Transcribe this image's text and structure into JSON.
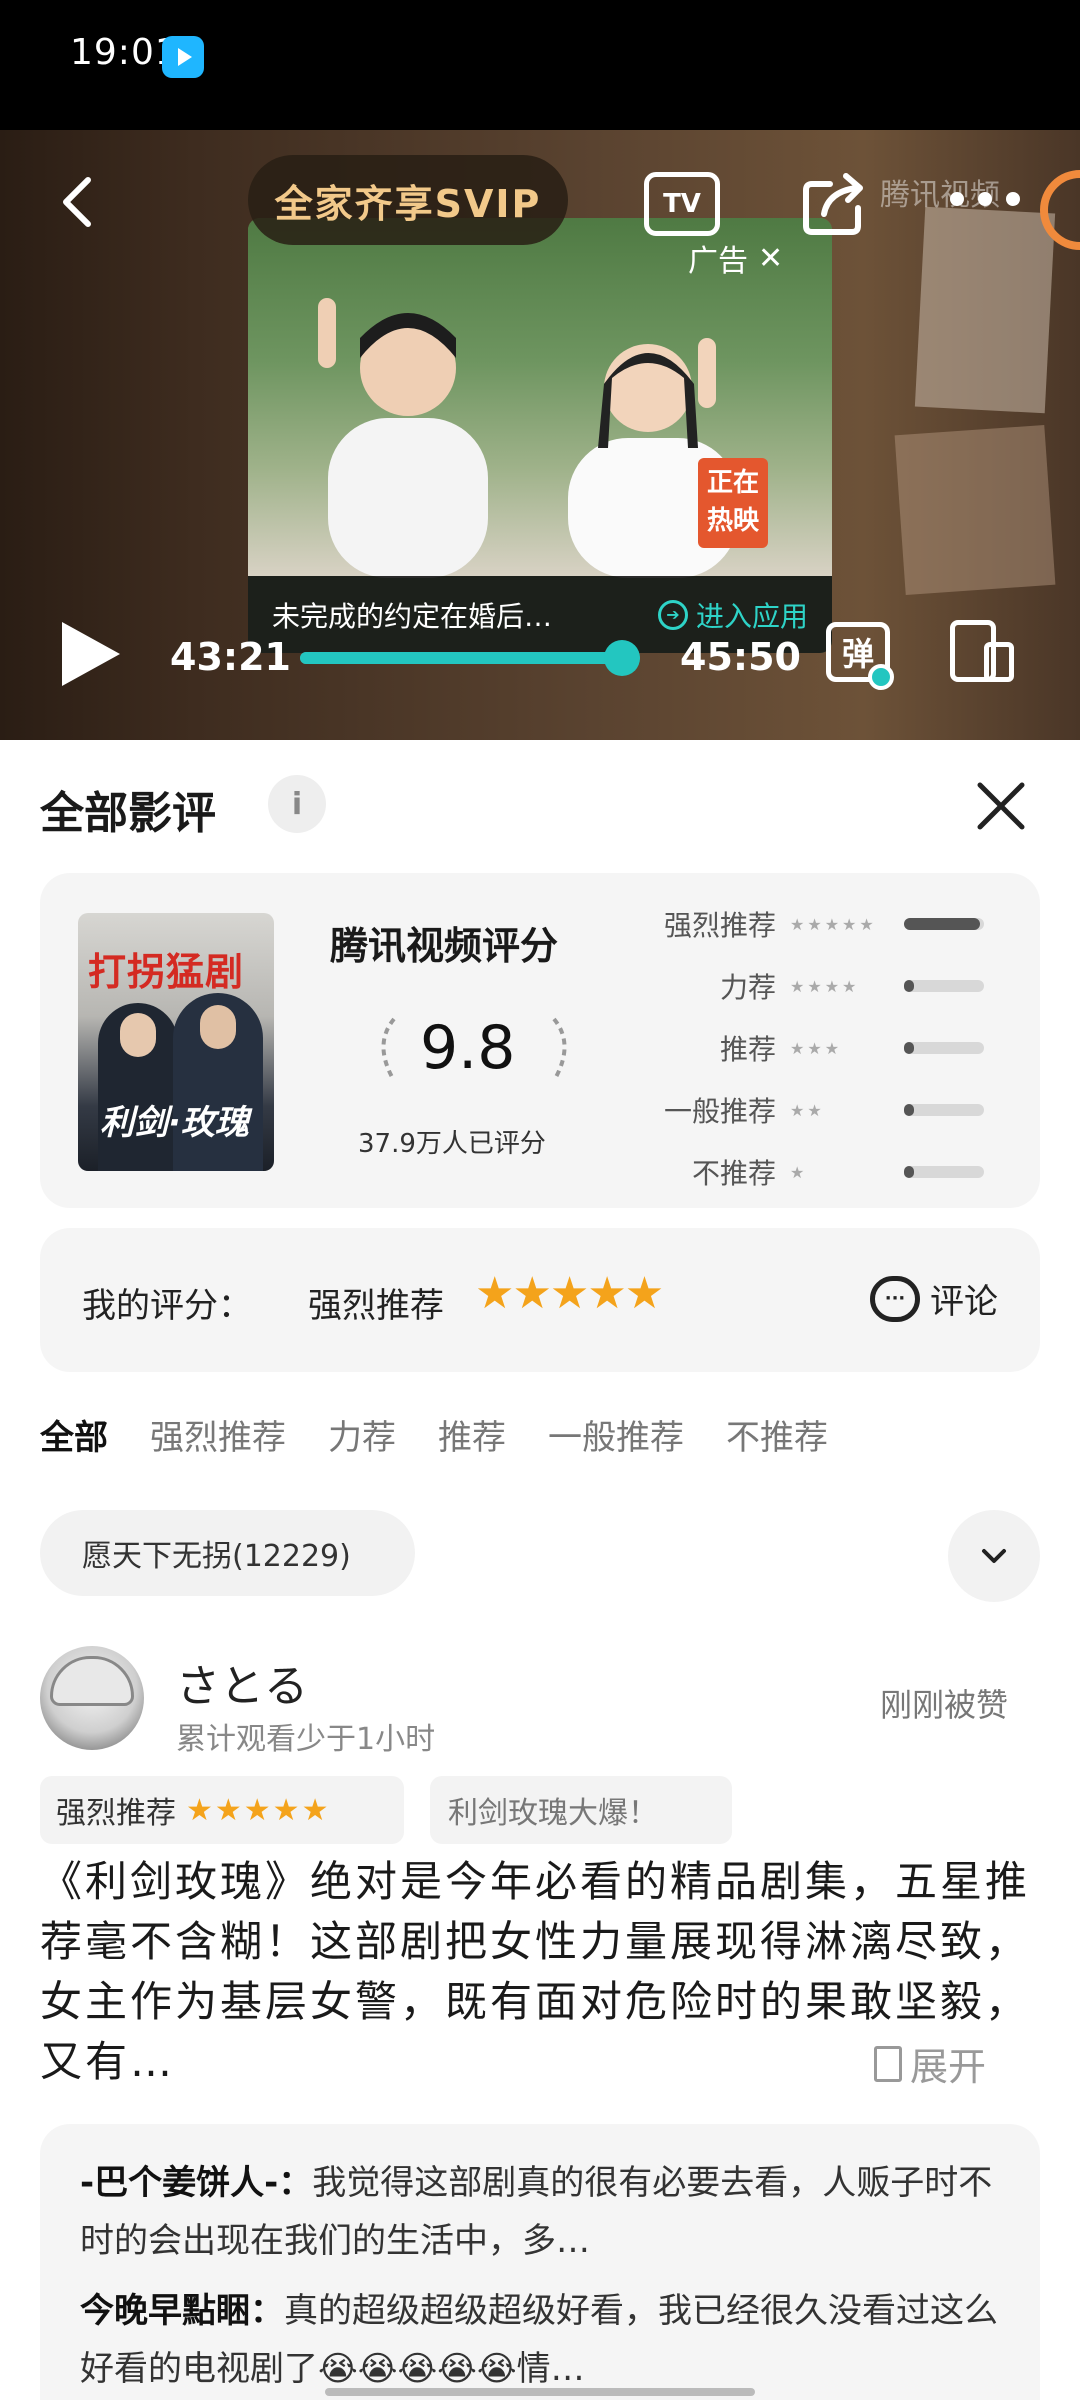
{
  "status_bar": {
    "time": "19:01"
  },
  "player": {
    "svip_label": "全家齐享SVIP",
    "tv_label": "TV",
    "watermark": "腾讯视频",
    "ad": {
      "label": "广告",
      "badge": "正在热映",
      "caption": "未完成的约定在婚后…",
      "enter_label": "进入应用"
    },
    "current_time": "43:21",
    "total_time": "45:50",
    "progress_fraction": 0.946,
    "danmu_label": "弹"
  },
  "panel": {
    "title": "全部影评",
    "info_icon": "i",
    "close_icon": "close-icon"
  },
  "rating_card": {
    "poster_top": "打拐猛剧",
    "poster_bottom": "利剑·玫瑰",
    "score_title": "腾讯视频评分",
    "score": "9.8",
    "score_count": "37.9万人已评分",
    "distribution": [
      {
        "label": "强烈推荐",
        "stars": "★★★★★",
        "fraction": 0.95
      },
      {
        "label": "力荐",
        "stars": "★★★★",
        "fraction": 0.05
      },
      {
        "label": "推荐",
        "stars": "★★★",
        "fraction": 0.03
      },
      {
        "label": "一般推荐",
        "stars": "★★",
        "fraction": 0.02
      },
      {
        "label": "不推荐",
        "stars": "★",
        "fraction": 0.02
      }
    ]
  },
  "my_rating": {
    "label": "我的评分：",
    "value": "强烈推荐",
    "stars": "★★★★★",
    "comment_label": "评论"
  },
  "filter_tabs": [
    "全部",
    "强烈推荐",
    "力荐",
    "推荐",
    "一般推荐",
    "不推荐"
  ],
  "topic_chip": "愿天下无拐(12229)",
  "review": {
    "user_name": "さとる",
    "user_meta": "累计观看少于1小时",
    "liked_text": "刚刚被赞",
    "rating_tag": "强烈推荐",
    "rating_stars": "★★★★★",
    "topic_tag": "利剑玫瑰大爆！",
    "body": "《利剑玫瑰》绝对是今年必看的精品剧集，五星推荐毫不含糊！这部剧把女性力量展现得淋漓尽致，女主作为基层女警，既有面对危险时的果敢坚毅，又有…",
    "expand_label": "展开"
  },
  "replies": [
    {
      "author": "-巴个姜饼人-：",
      "text": "我觉得这部剧真的很有必要去看，人贩子时不时的会出现在我们的生活中，多…"
    },
    {
      "author": "今晚早點睏：",
      "text": "真的超级超级超级好看，我已经很久没看过这么好看的电视剧了😭😭😭😭😭情…"
    }
  ]
}
